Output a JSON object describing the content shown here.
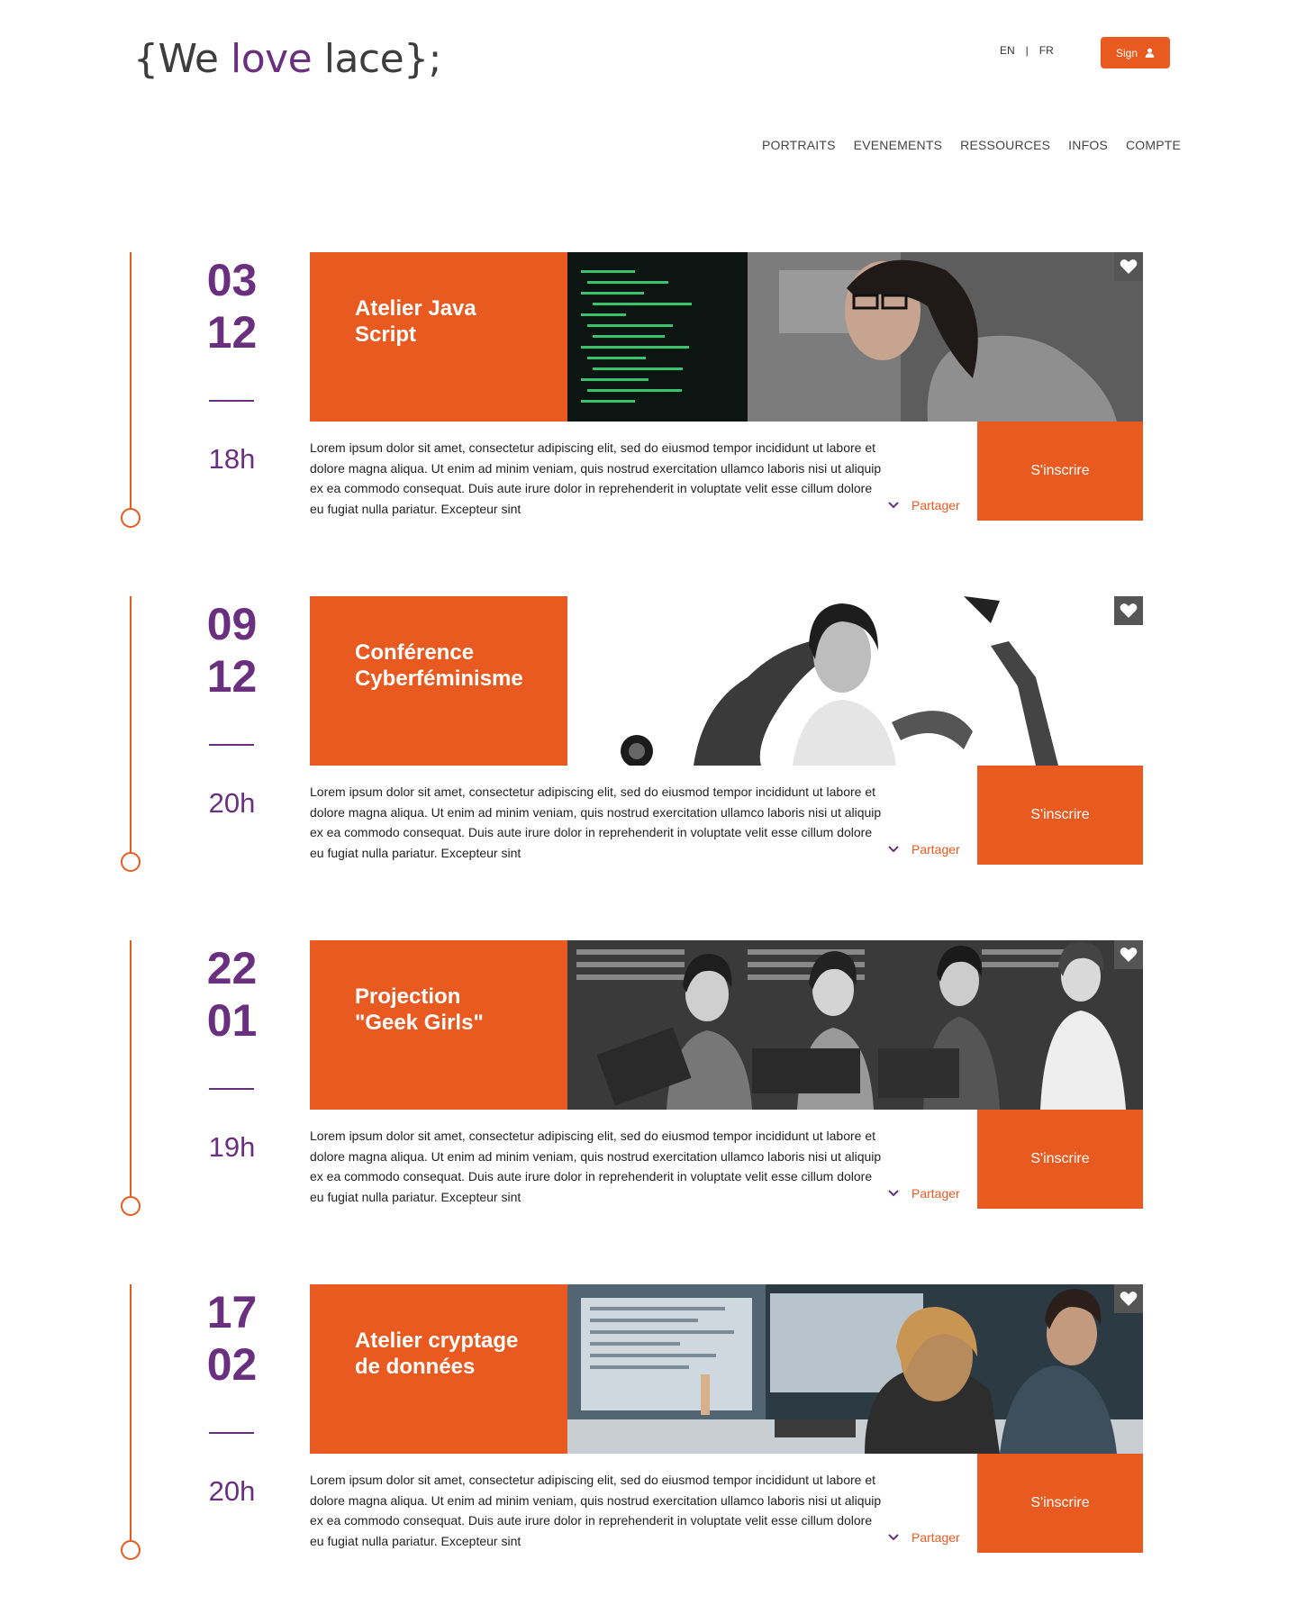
{
  "header": {
    "logo": {
      "open": "{We ",
      "accent": "love",
      "close": " lace};"
    },
    "lang": {
      "en": "EN",
      "sep": "|",
      "fr": "FR"
    },
    "sign_label": "Sign"
  },
  "nav": [
    "PORTRAITS",
    "EVENEMENTS",
    "RESSOURCES",
    "INFOS",
    "COMPTE"
  ],
  "events": [
    {
      "day": "03",
      "month": "12",
      "time": "18h",
      "title_1": "Atelier Java",
      "title_2": "Script",
      "description": "Lorem ipsum dolor sit amet, consectetur adipiscing elit, sed do eiusmod tempor incididunt ut labore et dolore magna aliqua. Ut enim ad minim veniam, quis nostrud exercitation ullamco laboris nisi ut aliquip ex ea commodo consequat. Duis aute irure dolor in reprehenderit in voluptate velit esse cillum dolore eu fugiat nulla pariatur. Excepteur sint",
      "share": "Partager",
      "signup": "S'inscrire"
    },
    {
      "day": "09",
      "month": "12",
      "time": "20h",
      "title_1": "Conférence",
      "title_2": "Cyberféminisme",
      "description": "Lorem ipsum dolor sit amet, consectetur adipiscing elit, sed do eiusmod tempor incididunt ut labore et dolore magna aliqua. Ut enim ad minim veniam, quis nostrud exercitation ullamco laboris nisi ut aliquip ex ea commodo consequat. Duis aute irure dolor in reprehenderit in voluptate velit esse cillum dolore eu fugiat nulla pariatur. Excepteur sint",
      "share": "Partager",
      "signup": "S'inscrire"
    },
    {
      "day": "22",
      "month": "01",
      "time": "19h",
      "title_1": "Projection",
      "title_2": "\"Geek Girls\"",
      "description": "Lorem ipsum dolor sit amet, consectetur adipiscing elit, sed do eiusmod tempor incididunt ut labore et dolore magna aliqua. Ut enim ad minim veniam, quis nostrud exercitation ullamco laboris nisi ut aliquip ex ea commodo consequat. Duis aute irure dolor in reprehenderit in voluptate velit esse cillum dolore eu fugiat nulla pariatur. Excepteur sint",
      "share": "Partager",
      "signup": "S'inscrire"
    },
    {
      "day": "17",
      "month": "02",
      "time": "20h",
      "title_1": "Atelier cryptage",
      "title_2": "de données",
      "description": "Lorem ipsum dolor sit amet, consectetur adipiscing elit, sed do eiusmod tempor incididunt ut labore et dolore magna aliqua. Ut enim ad minim veniam, quis nostrud exercitation ullamco laboris nisi ut aliquip ex ea commodo consequat. Duis aute irure dolor in reprehenderit in voluptate velit esse cillum dolore eu fugiat nulla pariatur. Excepteur sint",
      "share": "Partager",
      "signup": "S'inscrire"
    }
  ],
  "colors": {
    "accent": "#e95a20",
    "brand": "#6a2f7f",
    "dark": "#555555"
  }
}
